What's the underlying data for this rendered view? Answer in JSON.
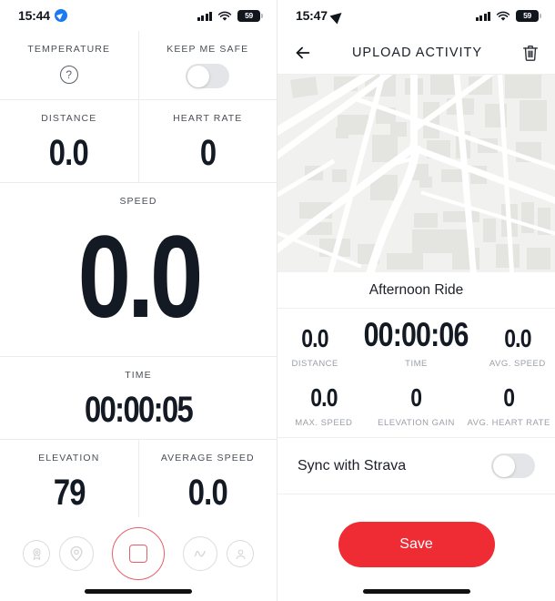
{
  "left_screen": {
    "status_bar": {
      "time": "15:44",
      "location_icon": "location-arrow-badge-icon",
      "signal_icon": "cellular-signal-icon",
      "wifi_icon": "wifi-icon",
      "battery_level": "59"
    },
    "metrics": [
      {
        "label": "TEMPERATURE",
        "value": "",
        "control": "help-circle-icon",
        "glyph": "?"
      },
      {
        "label": "KEEP ME SAFE",
        "value": "",
        "control": "toggle-switch",
        "state": "off"
      },
      {
        "label": "DISTANCE",
        "value": "0.0"
      },
      {
        "label": "HEART RATE",
        "value": "0"
      },
      {
        "label": "SPEED",
        "value": "0.0"
      },
      {
        "label": "TIME",
        "value": "00:00:05"
      },
      {
        "label": "ELEVATION",
        "value": "79"
      },
      {
        "label": "AVERAGE SPEED",
        "value": "0.0"
      }
    ],
    "nav": {
      "items": [
        {
          "name": "achievements-medal-icon",
          "size": "sm"
        },
        {
          "name": "location-pin-icon",
          "size": "md"
        },
        {
          "name": "stop-recording-button",
          "size": "lg"
        },
        {
          "name": "route-squiggle-icon",
          "size": "md"
        },
        {
          "name": "profile-avatar-icon",
          "size": "sm"
        }
      ],
      "accent_color": "#e2606a"
    }
  },
  "right_screen": {
    "status_bar": {
      "time": "15:47",
      "location_icon": "location-arrow-icon",
      "signal_icon": "cellular-signal-icon",
      "wifi_icon": "wifi-icon",
      "battery_level": "59"
    },
    "app_bar": {
      "back_icon": "back-arrow-icon",
      "title": "UPLOAD ACTIVITY",
      "delete_icon": "trash-icon"
    },
    "map": {
      "alt": "activity-route-map"
    },
    "activity_title": "Afternoon Ride",
    "stats_row_1": [
      {
        "value": "0.0",
        "label": "DISTANCE",
        "size": "small"
      },
      {
        "value": "00:00:06",
        "label": "TIME",
        "size": "large"
      },
      {
        "value": "0.0",
        "label": "AVG. SPEED",
        "size": "small"
      }
    ],
    "stats_row_2": [
      {
        "value": "0.0",
        "label": "MAX. SPEED"
      },
      {
        "value": "0",
        "label": "ELEVATION GAIN"
      },
      {
        "value": "0",
        "label": "AVG. HEART RATE"
      }
    ],
    "sync": {
      "label": "Sync with Strava",
      "state": "off"
    },
    "save_button": {
      "label": "Save",
      "color": "#ef2b34"
    }
  }
}
